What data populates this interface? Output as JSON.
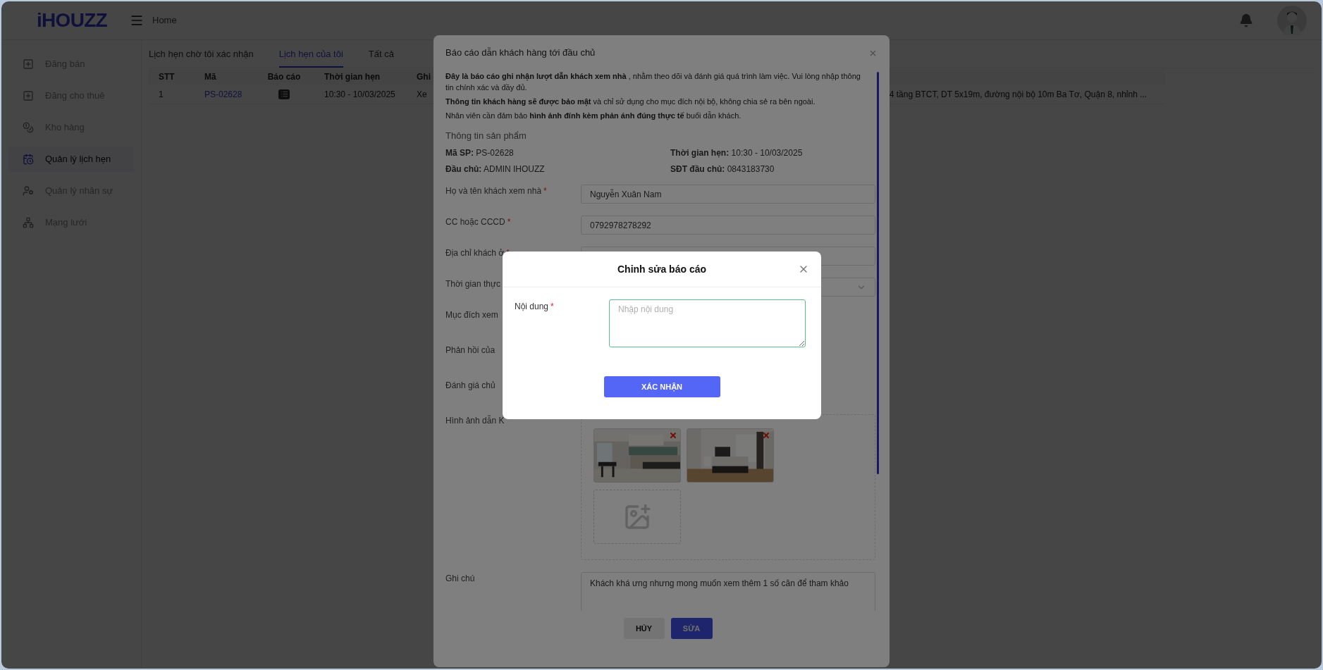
{
  "header": {
    "logo": "iHOUZZ",
    "breadcrumb": "Home"
  },
  "sidebar": {
    "items": [
      {
        "label": "Đăng bán",
        "selected": false
      },
      {
        "label": "Đăng cho thuê",
        "selected": false
      },
      {
        "label": "Kho hàng",
        "selected": false
      },
      {
        "label": "Quản lý lịch hẹn",
        "selected": true
      },
      {
        "label": "Quản lý nhân sự",
        "selected": false
      },
      {
        "label": "Mạng lưới",
        "selected": false
      }
    ]
  },
  "tabs": [
    {
      "label": "Lịch hẹn chờ tôi xác nhận",
      "selected": false
    },
    {
      "label": "Lịch hẹn của tôi",
      "selected": true
    },
    {
      "label": "Tất cả",
      "selected": false
    }
  ],
  "table": {
    "columns": [
      "STT",
      "Mã",
      "Báo cáo",
      "Thời gian hẹn",
      "Ghi"
    ],
    "rows": [
      {
        "stt": "1",
        "code": "PS-02628",
        "time": "10:30 - 10/03/2025",
        "note": "Xe",
        "note_tail": "4 tầng BTCT, DT 5x19m, đường nội bộ 10m Ba Tơ, Quận 8, nhỉnh ..."
      }
    ]
  },
  "report_modal": {
    "title": "Báo cáo dẫn khách hàng tới đầu chủ",
    "intro": [
      "**Đây là báo cáo ghi nhận lượt dẫn khách xem nhà** , nhằm theo dõi và đánh giá quá trình làm việc. Vui lòng nhập thông tin chính xác và đầy đủ.",
      "**Thông tin khách hàng sẽ được bảo mật** và chỉ sử dụng cho mục đích nội bộ, không chia sẻ ra bên ngoài.",
      "Nhân viên cần đảm bảo **hình ảnh đính kèm phản ánh đúng thực tế** buổi dẫn khách."
    ],
    "section": "Thông tin sản phẩm",
    "info": [
      {
        "label": "Mã SP:",
        "value": "PS-02628"
      },
      {
        "label": "Thời gian hẹn:",
        "value": "10:30 - 10/03/2025"
      },
      {
        "label": "Đầu chủ:",
        "value": "ADMIN IHOUZZ"
      },
      {
        "label": "SĐT đầu chủ:",
        "value": "0843183730"
      }
    ],
    "fields": [
      {
        "kind": "input",
        "label": "Họ và tên khách xem nhà",
        "required": true,
        "value": "Nguyễn Xuân Nam"
      },
      {
        "kind": "input",
        "label": "CC hoặc CCCD",
        "required": true,
        "value": "0792978278292"
      },
      {
        "kind": "input",
        "label": "Địa chỉ khách ở",
        "required": true
      },
      {
        "kind": "select",
        "label": "Thời gian thực",
        "required": false
      },
      {
        "kind": "covered",
        "label": "Mục đích xem",
        "required": false
      },
      {
        "kind": "covered",
        "label": "Phản hồi của",
        "required": false
      },
      {
        "kind": "covered",
        "label": "Đánh giá chủ",
        "required": false
      },
      {
        "kind": "images",
        "label": "Hình ảnh dẫn K",
        "required": false
      },
      {
        "kind": "textarea",
        "label": "Ghi chú",
        "required": false,
        "value": "Khách khá ưng nhưng mong muốn xem thêm 1 số căn để tham khảo"
      }
    ],
    "required_mark": "*",
    "cancel": "HỦY",
    "submit": "SỬA"
  },
  "edit_modal": {
    "title": "Chỉnh sửa báo cáo",
    "label": "Nội dung",
    "required": true,
    "required_mark": "*",
    "placeholder": "Nhập nội dung",
    "button": "XÁC NHẬN"
  }
}
